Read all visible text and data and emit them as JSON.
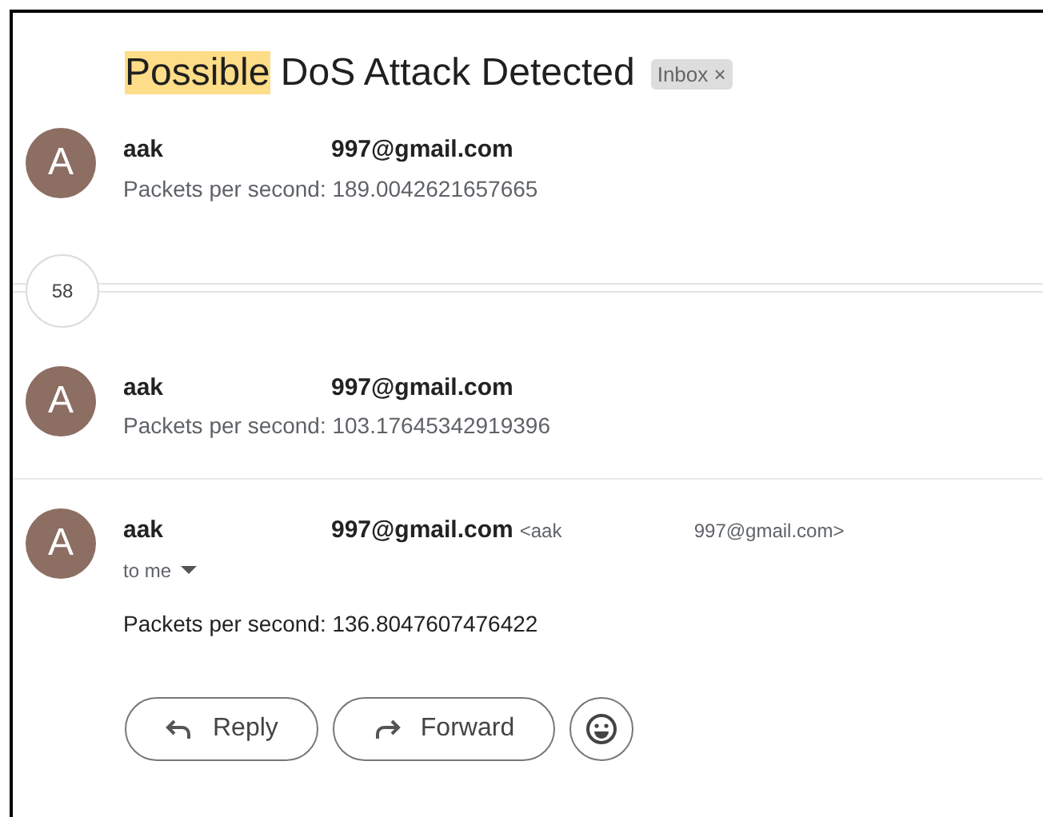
{
  "subject": {
    "parts": [
      {
        "text": "Possible",
        "highlighted": true
      },
      {
        "text": "DoS Attack Detected",
        "highlighted": false
      }
    ]
  },
  "label": {
    "text": "Inbox",
    "close": "×"
  },
  "thread": [
    {
      "kind": "collapsed",
      "avatar": "A",
      "sender_start": "aak",
      "sender_end": "997@gmail.com",
      "snippet": "Packets per second: 189.0042621657665"
    },
    {
      "kind": "hidden_count",
      "count": "58"
    },
    {
      "kind": "collapsed",
      "avatar": "A",
      "sender_start": "aak",
      "sender_end": "997@gmail.com",
      "snippet": "Packets per second: 103.17645342919396"
    },
    {
      "kind": "expanded",
      "avatar": "A",
      "sender_start": "aak",
      "sender_end": "997@gmail.com",
      "address_start": "<aak",
      "address_end": "997@gmail.com>",
      "recipient": "to me",
      "body": "Packets per second: 136.8047607476422"
    }
  ],
  "actions": [
    {
      "kind": "reply",
      "label": "Reply"
    },
    {
      "kind": "forward",
      "label": "Forward"
    },
    {
      "kind": "emoji"
    }
  ]
}
